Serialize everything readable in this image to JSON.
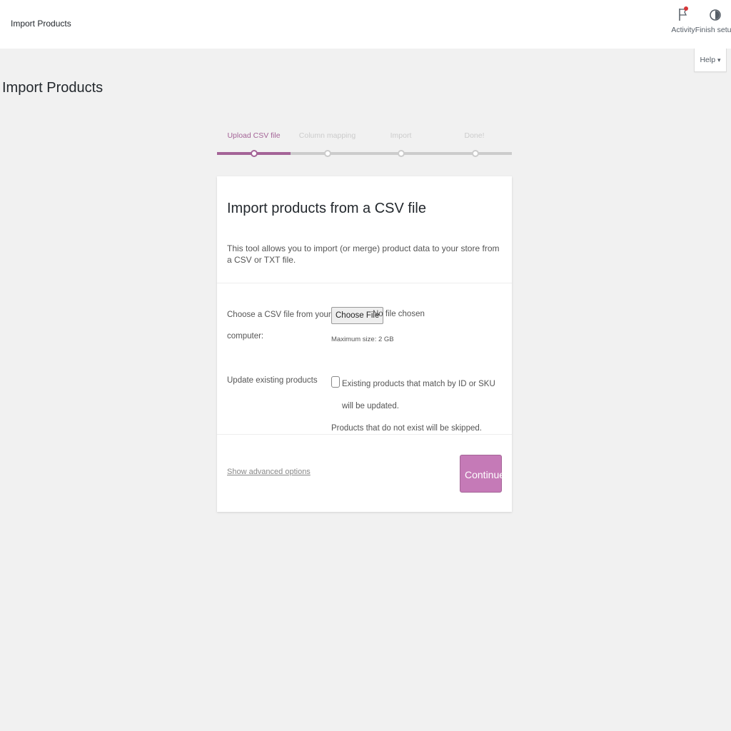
{
  "header": {
    "title": "Import Products",
    "activity_label": "Activity",
    "finish_setup_label": "Finish setup"
  },
  "help_tab": {
    "label": "Help",
    "arrow": "▾"
  },
  "page_title": "Import Products",
  "steps": [
    {
      "label": "Upload CSV file",
      "active": true
    },
    {
      "label": "Column mapping",
      "active": false
    },
    {
      "label": "Import",
      "active": false
    },
    {
      "label": "Done!",
      "active": false
    }
  ],
  "card": {
    "title": "Import products from a CSV file",
    "description": "This tool allows you to import (or merge) product data to your store from a CSV or TXT file.",
    "file_label_line1": "Choose a CSV file from your",
    "file_label_line2": "computer:",
    "choose_file_label": "Choose File",
    "no_file_text": "No file chosen",
    "max_size_text": "Maximum size: 2 GB",
    "update_label": "Update existing products",
    "update_desc_line1": "Existing products that match by ID or SKU will be updated.",
    "update_desc_line2": "Products that do not exist will be skipped.",
    "advanced_link": "Show advanced options",
    "continue_label": "Continue"
  },
  "colors": {
    "accent": "#a46497",
    "button": "#c57ab7",
    "background": "#f1f1f1",
    "activity_dot": "#d63638"
  },
  "icons": {
    "activity": "flag-icon",
    "finish_setup": "progress-circle-icon"
  }
}
